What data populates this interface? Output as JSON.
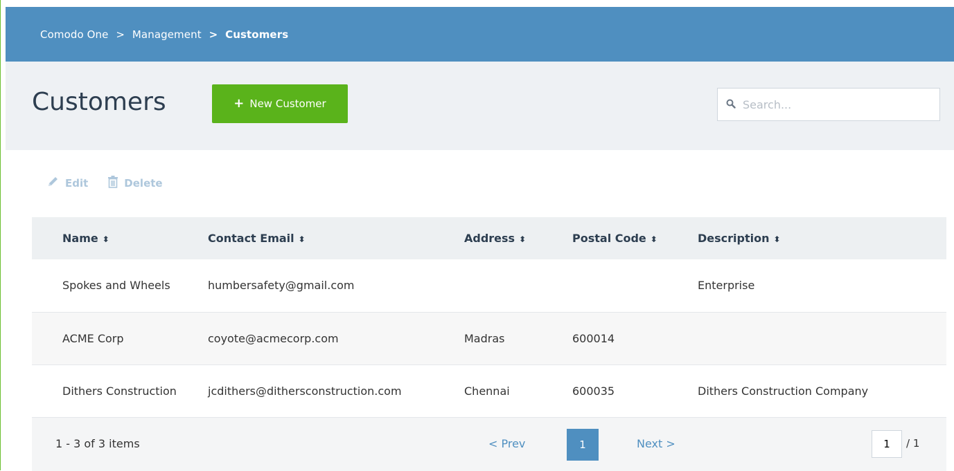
{
  "breadcrumb": {
    "items": [
      "Comodo One",
      "Management",
      "Customers"
    ],
    "separator": ">"
  },
  "page": {
    "title": "Customers",
    "new_button_label": "New Customer",
    "search_placeholder": "Search..."
  },
  "toolbar": {
    "edit_label": "Edit",
    "delete_label": "Delete"
  },
  "table": {
    "columns": [
      "Name",
      "Contact Email",
      "Address",
      "Postal Code",
      "Description"
    ],
    "rows": [
      {
        "name": "Spokes and Wheels",
        "email": "humbersafety@gmail.com",
        "address": "",
        "postal": "",
        "description": "Enterprise"
      },
      {
        "name": "ACME Corp",
        "email": "coyote@acmecorp.com",
        "address": "Madras",
        "postal": "600014",
        "description": ""
      },
      {
        "name": "Dithers Construction",
        "email": "jcdithers@dithersconstruction.com",
        "address": "Chennai",
        "postal": "600035",
        "description": "Dithers Construction Company"
      }
    ]
  },
  "pagination": {
    "summary": "1 - 3 of 3 items",
    "prev_label": "< Prev",
    "next_label": "Next >",
    "current_page": "1",
    "page_input_value": "1",
    "total_pages": "/ 1"
  },
  "colors": {
    "header_bar": "#4f8fc0",
    "accent_green": "#5ab31b",
    "link_blue": "#4f8fc0"
  },
  "icons": {
    "new": "plus-icon",
    "search": "search-icon",
    "edit": "pencil-icon",
    "delete": "trash-icon",
    "sort": "sort-icon"
  }
}
